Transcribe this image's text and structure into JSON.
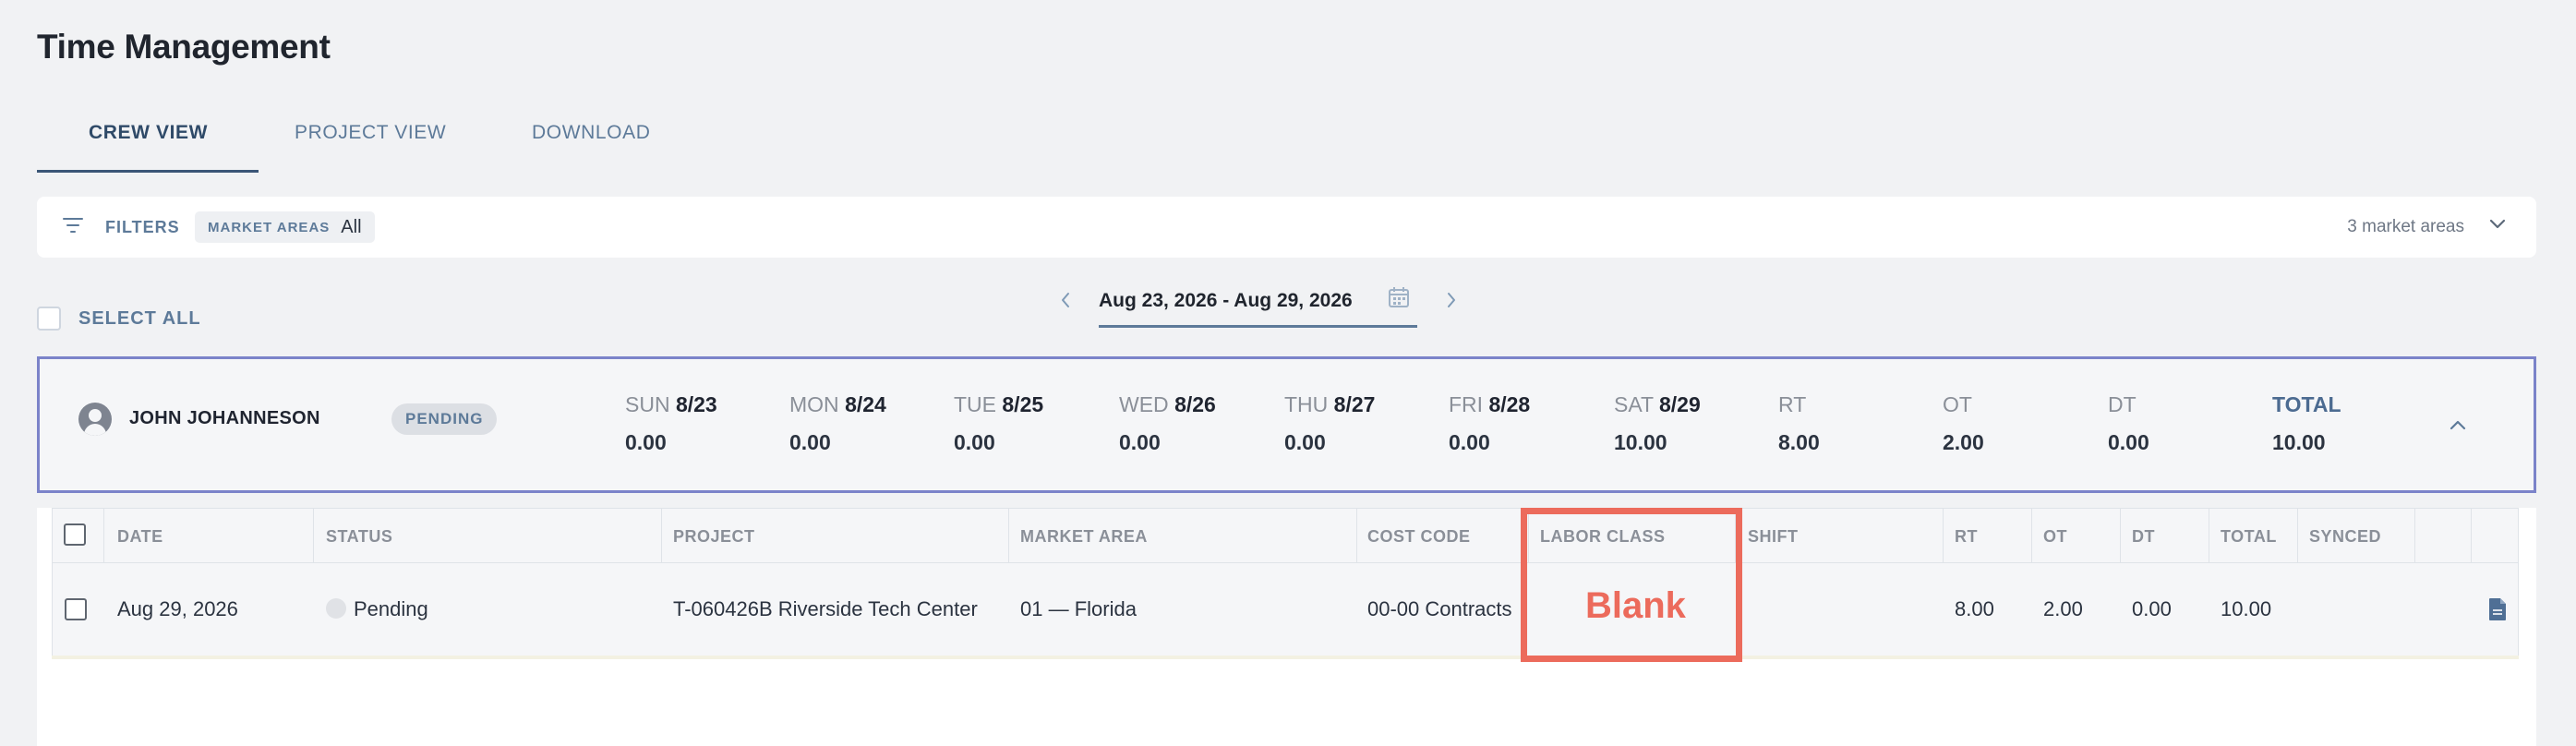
{
  "page": {
    "title": "Time Management"
  },
  "tabs": [
    {
      "label": "CREW VIEW",
      "active": true
    },
    {
      "label": "PROJECT VIEW",
      "active": false
    },
    {
      "label": "DOWNLOAD",
      "active": false
    }
  ],
  "filters": {
    "label": "FILTERS",
    "chip_label": "MARKET AREAS",
    "chip_value": "All",
    "market_count": "3 market areas"
  },
  "select_all": {
    "label": "SELECT ALL"
  },
  "date_range": {
    "label": "Aug 23, 2026 - Aug 29, 2026"
  },
  "summary": {
    "name": "JOHN JOHANNESON",
    "status": "PENDING",
    "days": [
      {
        "dow": "SUN",
        "date": "8/23",
        "value": "0.00"
      },
      {
        "dow": "MON",
        "date": "8/24",
        "value": "0.00"
      },
      {
        "dow": "TUE",
        "date": "8/25",
        "value": "0.00"
      },
      {
        "dow": "WED",
        "date": "8/26",
        "value": "0.00"
      },
      {
        "dow": "THU",
        "date": "8/27",
        "value": "0.00"
      },
      {
        "dow": "FRI",
        "date": "8/28",
        "value": "0.00"
      },
      {
        "dow": "SAT",
        "date": "8/29",
        "value": "10.00"
      }
    ],
    "totals": [
      {
        "label": "RT",
        "value": "8.00"
      },
      {
        "label": "OT",
        "value": "2.00"
      },
      {
        "label": "DT",
        "value": "0.00"
      },
      {
        "label": "TOTAL",
        "value": "10.00"
      }
    ]
  },
  "table": {
    "headers": {
      "date": "DATE",
      "status": "STATUS",
      "project": "PROJECT",
      "market_area": "MARKET AREA",
      "cost_code": "COST CODE",
      "labor_class": "LABOR CLASS",
      "shift": "SHIFT",
      "rt": "RT",
      "ot": "OT",
      "dt": "DT",
      "total": "TOTAL",
      "synced": "SYNCED"
    },
    "row": {
      "date": "Aug 29, 2026",
      "status": "Pending",
      "project": "T-060426B Riverside Tech Center",
      "market_area": "01 — Florida",
      "cost_code": "00-00 Contracts",
      "rt": "8.00",
      "ot": "2.00",
      "dt": "0.00",
      "total": "10.00"
    }
  },
  "annotation": {
    "text": "Blank",
    "color": "#ec6b5c"
  },
  "colors": {
    "accent": "#5d7a99",
    "selected_border": "#7b83c9",
    "highlight": "#ec6b5c"
  }
}
